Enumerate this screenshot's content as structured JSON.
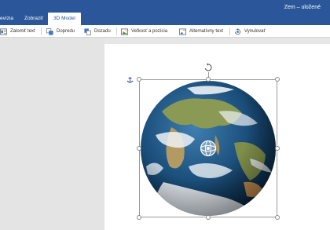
{
  "window": {
    "title": "Zem – uložené"
  },
  "tabs": [
    {
      "label": "evízia",
      "active": false
    },
    {
      "label": "Zobraziť",
      "active": false
    },
    {
      "label": "3D Model",
      "active": true
    }
  ],
  "ribbon": {
    "wrap_text": {
      "label": "Zalomiť text",
      "icon": "wrap-text-icon"
    },
    "bring_forward": {
      "label": "Dopredu",
      "icon": "bring-forward-icon"
    },
    "send_backward": {
      "label": "Dozadu",
      "icon": "send-backward-icon"
    },
    "size_position": {
      "label": "Veľkosť a pozícia",
      "icon": "size-position-icon"
    },
    "alt_text": {
      "label": "Alternatívny text",
      "icon": "alt-text-icon"
    },
    "reset": {
      "label": "Vynulovať",
      "icon": "reset-icon"
    }
  },
  "colors": {
    "title_bar": "#2b579a",
    "ocean": "#1b4f7c",
    "land": "#8a9a55",
    "cloud": "#eef2f5"
  }
}
